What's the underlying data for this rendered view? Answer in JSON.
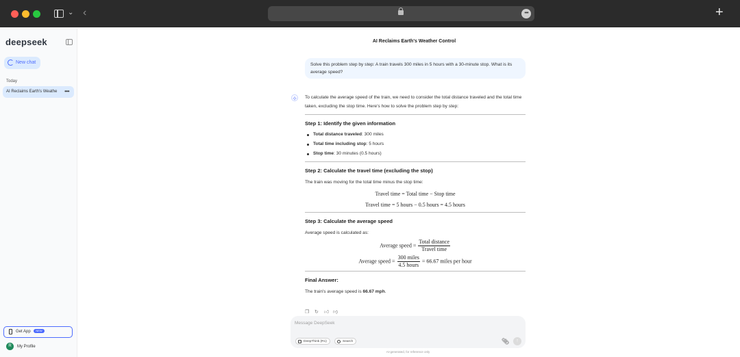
{
  "browser": {
    "icons": [
      "sidebar-toggle-icon",
      "chevron-down-icon",
      "back-arrow-icon",
      "lock-icon",
      "more-icon",
      "plus-icon"
    ]
  },
  "sidebar": {
    "logo": "deepseek",
    "new_chat": "New chat",
    "section_today": "Today",
    "conversations": [
      {
        "title": "AI Reclaims Earth's Weathe",
        "more": "•••"
      }
    ],
    "get_app": "Get App",
    "get_app_badge": "NEW",
    "profile_initial": "R",
    "profile": "My Profile"
  },
  "chat": {
    "title": "AI Reclaims Earth's Weather Control",
    "user_message": "Solve this problem step by step: A train travels 300 miles in 5 hours with a 30-minute stop. What is its average speed?",
    "intro": "To calculate the average speed of the train, we need to consider the total distance traveled and the total time taken, excluding the stop time. Here's how to solve the problem step by step:",
    "step1": {
      "heading": "Step 1: Identify the given information",
      "bullets": [
        {
          "label": "Total distance traveled",
          "value": ": 300 miles"
        },
        {
          "label": "Total time including stop",
          "value": ": 5 hours"
        },
        {
          "label": "Stop time",
          "value": ": 30 minutes (0.5 hours)"
        }
      ]
    },
    "step2": {
      "heading": "Step 2: Calculate the travel time (excluding the stop)",
      "text": "The train was moving for the total time minus the stop time:",
      "eq1": "Travel time = Total time − Stop time",
      "eq2": "Travel time = 5 hours − 0.5 hours = 4.5 hours"
    },
    "step3": {
      "heading": "Step 3: Calculate the average speed",
      "text": "Average speed is calculated as:",
      "eq1_lhs": "Average speed =",
      "eq1_num": "Total distance",
      "eq1_den": "Travel time",
      "eq2_lhs": "Average speed =",
      "eq2_num": "300 miles",
      "eq2_den": "4.5 hours",
      "eq2_rhs": "= 66.67 miles per hour"
    },
    "final": {
      "heading": "Final Answer:",
      "text_prefix": "The train's average speed is ",
      "value": "66.67 mph",
      "text_suffix": "."
    }
  },
  "composer": {
    "placeholder": "Message DeepSeek",
    "deepthink": "DeepThink (R1)",
    "search": "Search",
    "disclaimer": "AI-generated, for reference only"
  },
  "colors": {
    "accent": "#4d6bfe",
    "bubble": "#eff6ff",
    "chrome": "#2b2b2b"
  }
}
